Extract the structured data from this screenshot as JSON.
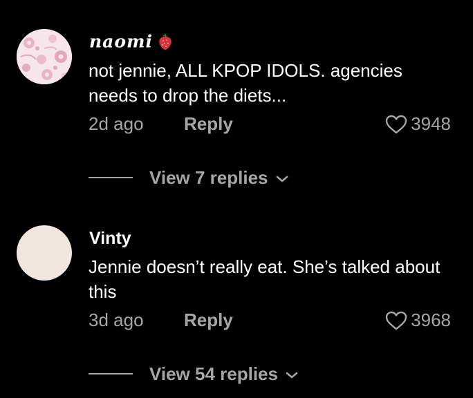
{
  "comments": [
    {
      "username": "naomi",
      "text": "not jennie, ALL KPOP IDOLS. agencies needs to drop the diets...",
      "time": "2d ago",
      "reply_label": "Reply",
      "likes": "3948",
      "replies_label": "View 7 replies",
      "avatar": "pink-floral-avatar",
      "badge": "strawberry-icon"
    },
    {
      "username": "Vinty",
      "text": "Jennie doesn’t really eat. She’s talked about this",
      "time": "3d ago",
      "reply_label": "Reply",
      "likes": "3968",
      "replies_label": "View 54 replies",
      "avatar": "plain-beige-avatar"
    }
  ],
  "colors": {
    "background": "#000000",
    "primary_text": "#ffffff",
    "secondary_text": "#a6a6a6",
    "avatar_naomi": "#f4e3e8",
    "avatar_vinty": "#f1e6dd"
  }
}
